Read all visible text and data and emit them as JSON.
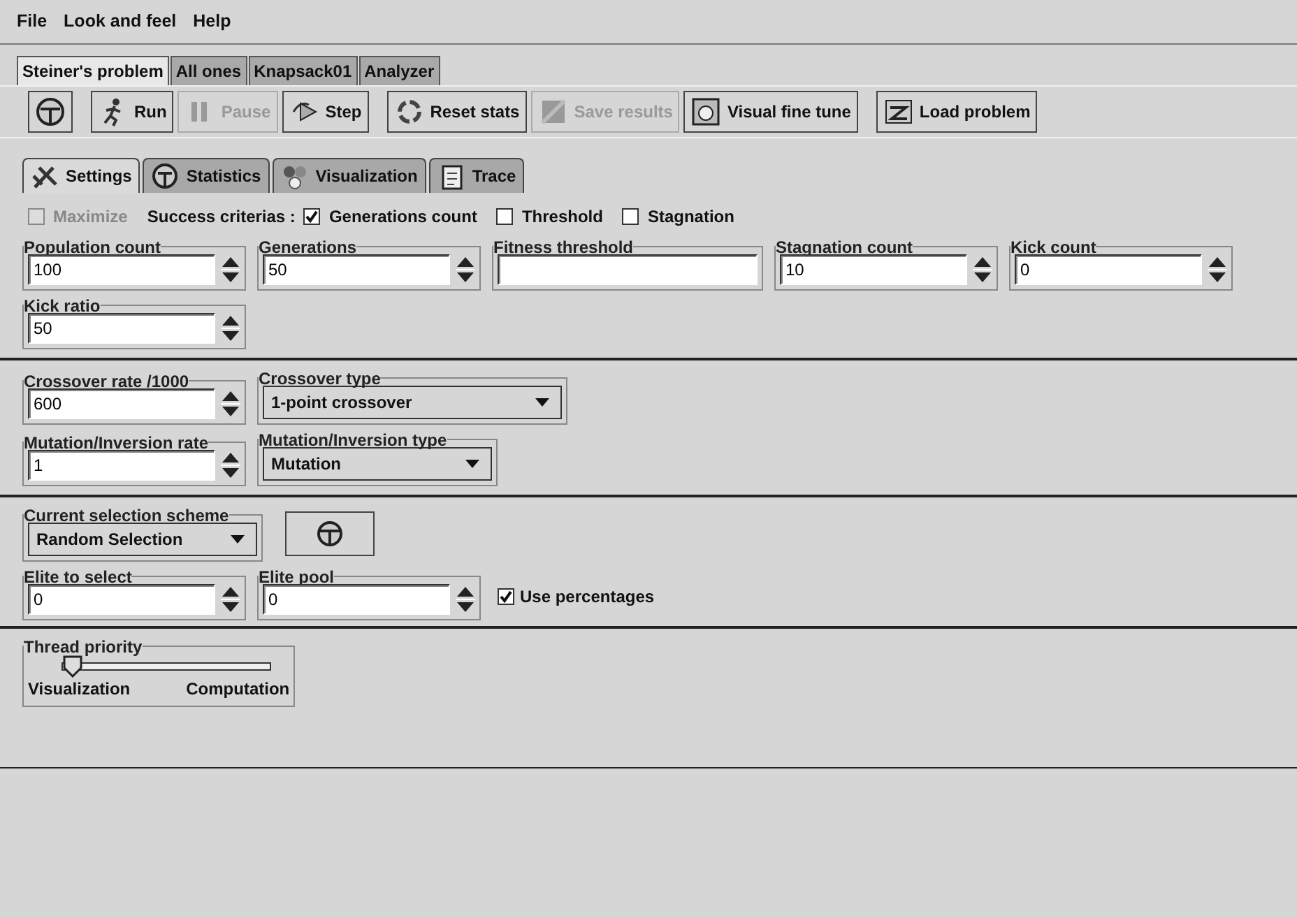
{
  "menu": [
    "File",
    "Look and feel",
    "Help"
  ],
  "problem_tabs": [
    {
      "label": "Steiner's problem",
      "selected": true
    },
    {
      "label": "All ones",
      "selected": false
    },
    {
      "label": "Knapsack01",
      "selected": false
    },
    {
      "label": "Analyzer",
      "selected": false
    }
  ],
  "toolbar": [
    {
      "disabled": false
    },
    {
      "label": "Run",
      "disabled": false
    },
    {
      "label": "Pause",
      "disabled": true
    },
    {
      "label": "Step",
      "disabled": false
    },
    {
      "label": "Reset stats",
      "disabled": false
    },
    {
      "label": "Save results",
      "disabled": true
    },
    {
      "label": "Visual fine tune",
      "disabled": false
    },
    {
      "label": "Load problem",
      "disabled": false
    }
  ],
  "settings_tabs": [
    {
      "label": "Settings",
      "selected": true
    },
    {
      "label": "Statistics",
      "selected": false
    },
    {
      "label": "Visualization",
      "selected": false
    },
    {
      "label": "Trace",
      "selected": false
    }
  ],
  "maximize": {
    "label": "Maximize",
    "checked": false,
    "disabled": true
  },
  "success_label": "Success criterias :",
  "criteria": [
    {
      "label": "Generations count",
      "checked": true
    },
    {
      "label": "Threshold",
      "checked": false
    },
    {
      "label": "Stagnation",
      "checked": false
    }
  ],
  "sections": [
    {
      "rows": [
        [
          {
            "kind": "spinner",
            "title": "Population count",
            "value": "100"
          },
          {
            "kind": "spinner",
            "title": "Generations",
            "value": "50"
          },
          {
            "kind": "text",
            "title": "Fitness threshold"
          },
          {
            "kind": "spinner",
            "title": "Stagnation count",
            "value": "10"
          },
          {
            "kind": "spinner",
            "title": "Kick count",
            "value": "0"
          }
        ],
        [
          {
            "kind": "spinner",
            "title": "Kick ratio",
            "value": "50"
          }
        ]
      ]
    },
    {
      "rows": [
        [
          {
            "kind": "spinner",
            "title": "Crossover rate /1000",
            "value": "600"
          },
          {
            "kind": "combo",
            "title": "Crossover type",
            "value": "1-point crossover"
          }
        ],
        [
          {
            "kind": "spinner",
            "title": "Mutation/Inversion rate",
            "value": "1"
          },
          {
            "kind": "combo",
            "title": "Mutation/Inversion type",
            "value": "Mutation"
          }
        ]
      ]
    },
    {
      "rows": [
        [
          {
            "kind": "combo",
            "title": "Current selection scheme",
            "value": "Random Selection"
          },
          {
            "kind": "iconbutton"
          }
        ],
        [
          {
            "kind": "spinner",
            "title": "Elite to select",
            "value": "0"
          },
          {
            "kind": "spinner",
            "title": "Elite pool",
            "value": "0"
          },
          {
            "kind": "checkbox",
            "label": "Use percentages",
            "checked": true
          }
        ]
      ]
    },
    {
      "rows": [
        [
          {
            "kind": "slider",
            "title": "Thread priority",
            "level": 0.05,
            "min_label": "Visualization",
            "max_label": "Computation"
          }
        ]
      ]
    }
  ]
}
